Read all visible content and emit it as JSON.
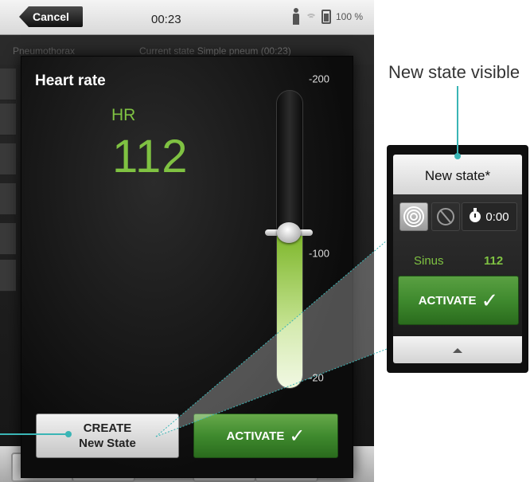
{
  "statusbar": {
    "cancel_label": "Cancel",
    "clock": "00:23",
    "battery": "100 %"
  },
  "subheader": {
    "left": "Pneumothorax",
    "current_state_prefix": "Current state",
    "current_state_value": "Simple pneum (00:23)"
  },
  "modal": {
    "title": "Heart rate",
    "param_label": "HR",
    "param_value": "112",
    "slider": {
      "min": 20,
      "max": 200,
      "value": 112,
      "tick_labels": [
        "-200",
        "-100",
        "-20"
      ],
      "tick_values": [
        200,
        100,
        20
      ]
    },
    "create_line1": "CREATE",
    "create_line2": "New State",
    "activate_label": "ACTIVATE",
    "check_glyph": "✓"
  },
  "callout": {
    "label": "New state visible",
    "card_title": "New state*",
    "timer": "0:00",
    "rhythm": "Sinus",
    "hr": "112",
    "activate_label": "ACTIVATE",
    "check_glyph": "✓"
  },
  "colors": {
    "accent_green": "#7fc242",
    "teal_callout": "#3ab5b5"
  }
}
